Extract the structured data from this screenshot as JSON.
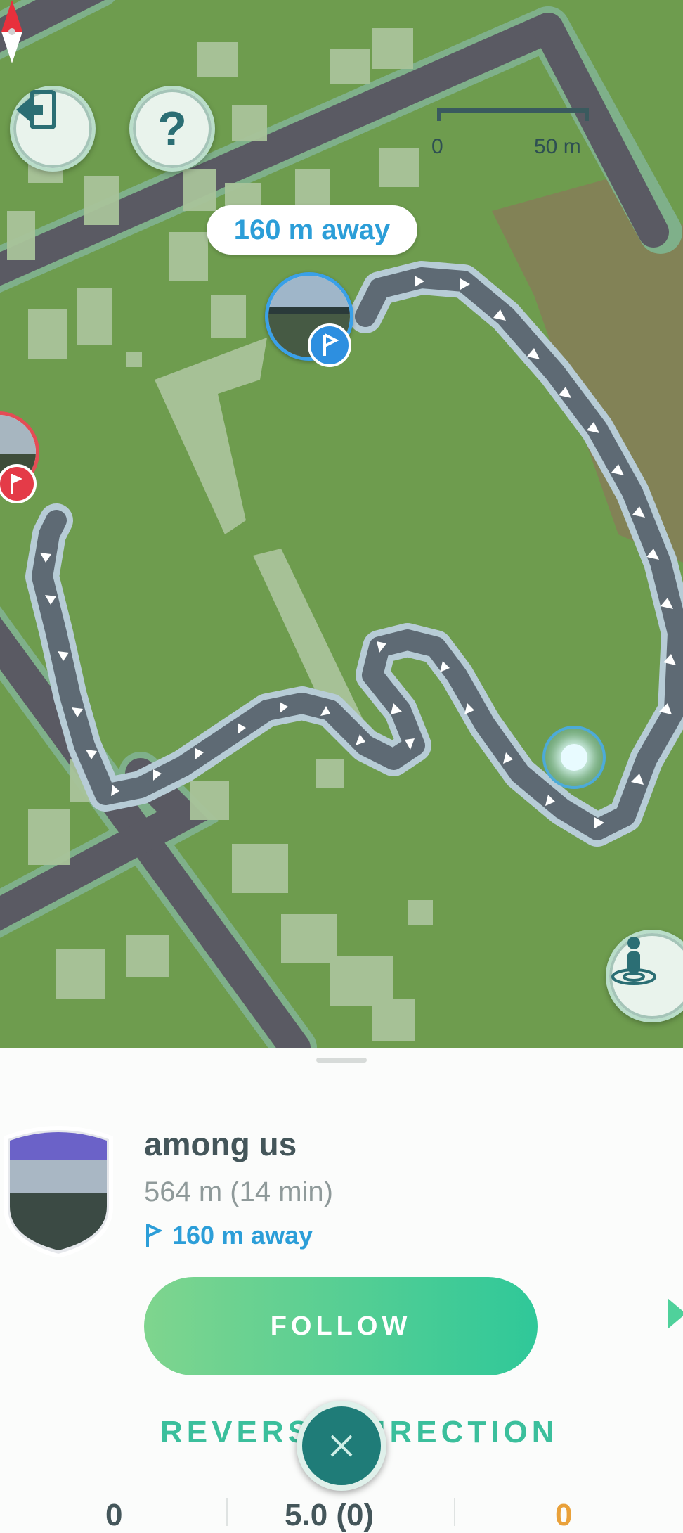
{
  "map": {
    "scale": {
      "zero_label": "0",
      "max_label": "50 m"
    },
    "distance_pill": "160 m away",
    "buttons": {
      "exit_icon": "exit-icon",
      "help_label": "?",
      "ar_icon": "person-pin-icon"
    },
    "compass_icon": "compass-icon"
  },
  "route": {
    "name": "among us",
    "length": "564 m (14 min)",
    "away": "160 m away",
    "follow_label": "FOLLOW",
    "reverse_label": "REVERSE DIRECTION",
    "stats": [
      "0",
      "5.0 (0)",
      "0"
    ]
  },
  "colors": {
    "accent": "#2c9ed8",
    "follow_start": "#7fd58e",
    "follow_end": "#2fc899",
    "close_button": "#1f7c78"
  }
}
